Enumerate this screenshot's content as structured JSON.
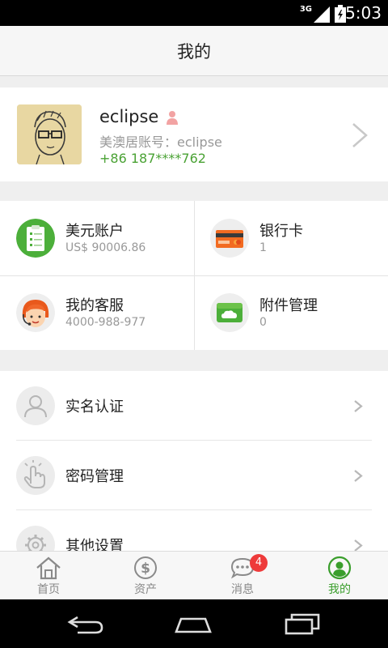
{
  "status_bar": {
    "network": "3G",
    "time": "5:03"
  },
  "header": {
    "title": "我的"
  },
  "profile": {
    "name": "eclipse",
    "account_label": "美澳居账号：eclipse",
    "phone": "+86 187****762"
  },
  "grid": [
    {
      "title": "美元账户",
      "subtitle": "US$ 90006.86",
      "icon": "clipboard-icon"
    },
    {
      "title": "银行卡",
      "subtitle": "1",
      "icon": "bank-card-icon"
    },
    {
      "title": "我的客服",
      "subtitle": "4000-988-977",
      "icon": "customer-service-icon"
    },
    {
      "title": "附件管理",
      "subtitle": "0",
      "icon": "cloud-folder-icon"
    }
  ],
  "list": [
    {
      "label": "实名认证",
      "icon": "user-verify-icon"
    },
    {
      "label": "密码管理",
      "icon": "password-hand-icon"
    },
    {
      "label": "其他设置",
      "icon": "gear-icon"
    }
  ],
  "tabs": [
    {
      "label": "首页",
      "icon": "home-icon",
      "active": false
    },
    {
      "label": "资产",
      "icon": "dollar-icon",
      "active": false
    },
    {
      "label": "消息",
      "icon": "chat-icon",
      "active": false,
      "badge": "4"
    },
    {
      "label": "我的",
      "icon": "profile-icon",
      "active": true
    }
  ],
  "colors": {
    "accent_green": "#3a9e2c",
    "badge_red": "#ee3b3b"
  }
}
